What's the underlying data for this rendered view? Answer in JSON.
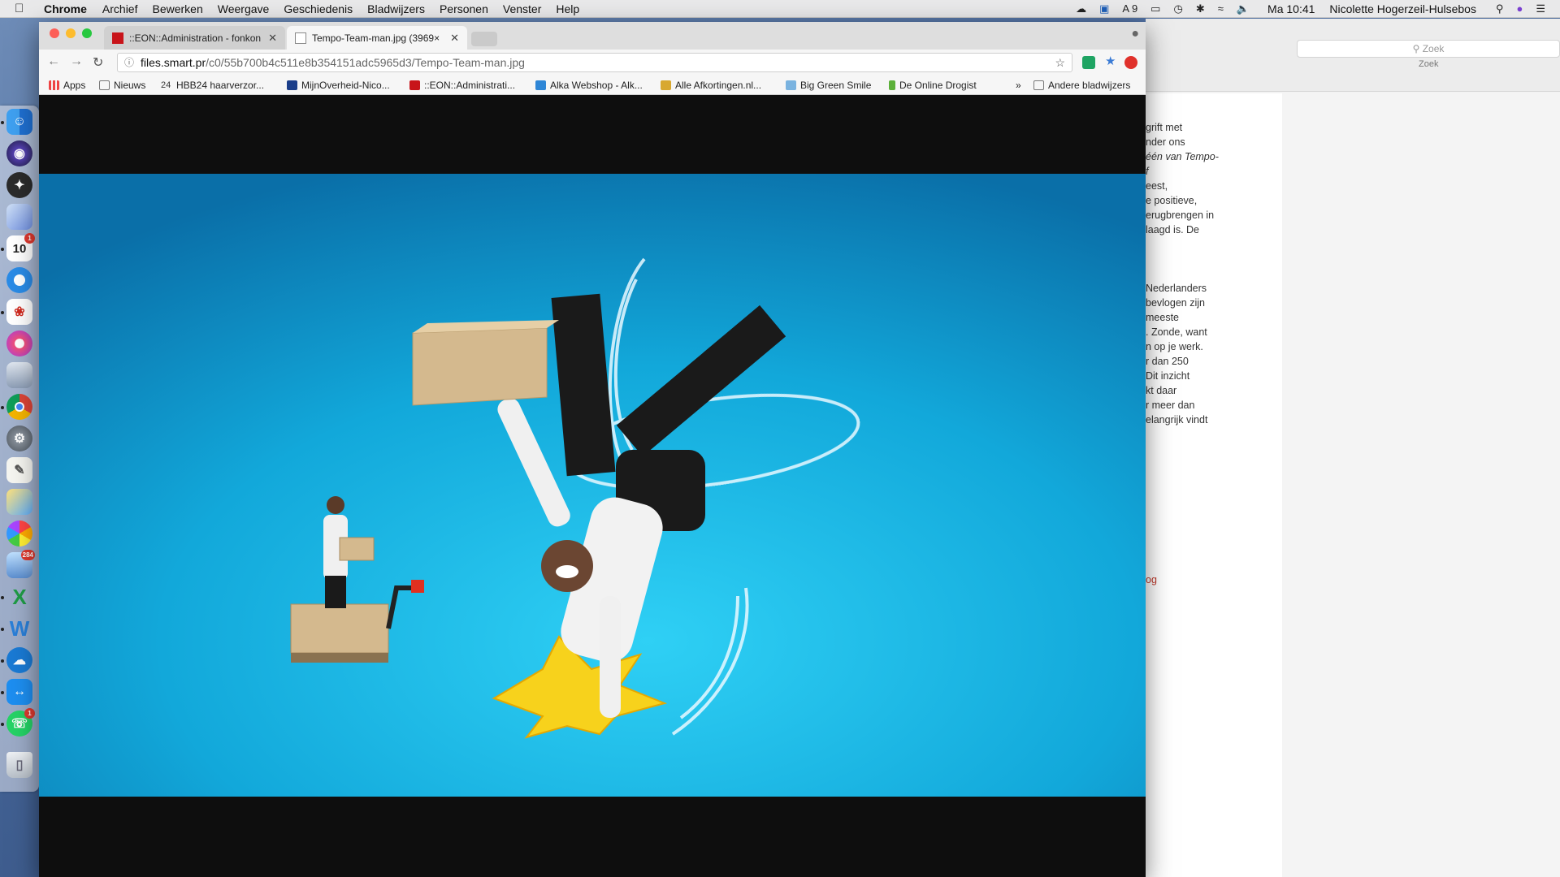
{
  "menubar": {
    "app": "Chrome",
    "items": [
      "Archief",
      "Bewerken",
      "Weergave",
      "Geschiedenis",
      "Bladwijzers",
      "Personen",
      "Venster",
      "Help"
    ],
    "status_count": "9",
    "clock": "Ma 10:41",
    "user": "Nicolette Hogerzeil-Hulsebos"
  },
  "tabs": [
    {
      "title": "::EON::Administration - fonkon"
    },
    {
      "title": "Tempo-Team-man.jpg (3969×"
    }
  ],
  "address": {
    "host": "files.smart.pr",
    "path": "/c0/55b700b4c511e8b354151adc5965d3/Tempo-Team-man.jpg"
  },
  "bookmarks": [
    "Apps",
    "Nieuws",
    "HBB24 haarverzor...",
    "MijnOverheid-Nico...",
    "::EON::Administrati...",
    "Alka Webshop - Alk...",
    "Alle Afkortingen.nl...",
    "Big Green Smile",
    "De Online Drogist"
  ],
  "bookmarks_more": "»",
  "other_bookmarks": "Andere bladwijzers",
  "bg_app": {
    "search_placeholder": "Zoek",
    "search_label": "Zoek",
    "lines": [
      "grift met",
      "nder ons",
      "één van Tempo-",
      "f",
      "eest,",
      "e positieve,",
      "erugbrengen in",
      "laagd is. De",
      "Nederlanders",
      "bevlogen zijn",
      "meeste",
      ". Zonde, want",
      "n op je werk.",
      "r dan 250",
      "Dit inzicht",
      "kt daar",
      "r meer dan",
      "elangrijk vindt",
      "og"
    ]
  },
  "dock": {
    "calendar_day": "10",
    "calendar_badge": "1",
    "photos_badge": "284",
    "whatsapp_badge": "1"
  },
  "colors": {
    "photo_bg": "#1aa4d6",
    "chrome_green": "#1fa463",
    "close": "#fc5f57",
    "minimize": "#fdbc2e",
    "zoom": "#28c840"
  }
}
